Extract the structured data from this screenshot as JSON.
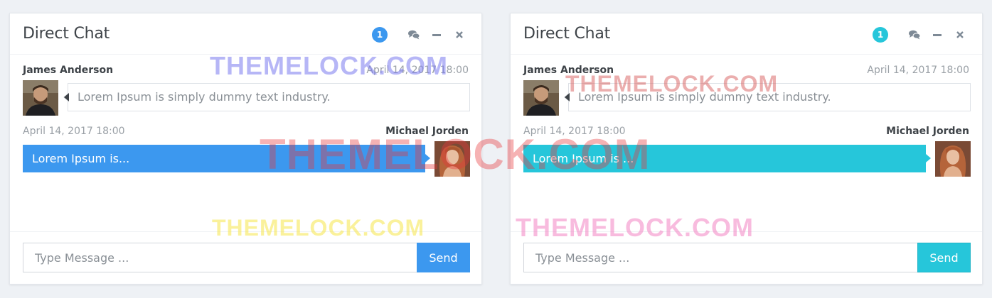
{
  "panels": [
    {
      "title": "Direct Chat",
      "badge_count": "1",
      "accent_color": "#3c98ef",
      "badge_color": "#3c98ef",
      "tools": [
        "comments-icon",
        "minus-icon",
        "close-icon"
      ],
      "messages": [
        {
          "direction": "in",
          "sender": "James Anderson",
          "timestamp": "April 14, 2017 18:00",
          "text": "Lorem Ipsum is simply dummy text industry."
        },
        {
          "direction": "out",
          "sender": "Michael Jorden",
          "timestamp": "April 14, 2017 18:00",
          "text": "Lorem Ipsum is..."
        }
      ],
      "composer": {
        "placeholder": "Type Message ...",
        "send_label": "Send"
      }
    },
    {
      "title": "Direct Chat",
      "badge_count": "1",
      "accent_color": "#26c6da",
      "badge_color": "#26c6da",
      "tools": [
        "comments-icon",
        "minus-icon",
        "close-icon"
      ],
      "messages": [
        {
          "direction": "in",
          "sender": "James Anderson",
          "timestamp": "April 14, 2017 18:00",
          "text": "Lorem Ipsum is simply dummy text industry."
        },
        {
          "direction": "out",
          "sender": "Michael Jorden",
          "timestamp": "April 14, 2017 18:00",
          "text": "Lorem Ipsum is ..."
        }
      ],
      "composer": {
        "placeholder": "Type Message ...",
        "send_label": "Send"
      }
    }
  ],
  "watermarks": [
    {
      "text": "THEMELOCK.COM",
      "color": "#7c7cf0"
    },
    {
      "text": "THEMELOCK.COM",
      "color": "#e8363b"
    },
    {
      "text": "THEMELOCK.COM",
      "color": "#f7e64a"
    },
    {
      "text": "THEMELOCK.COM",
      "color": "#d9605f"
    },
    {
      "text": "THEMELOCK.COM",
      "color": "#f06ab8"
    }
  ]
}
